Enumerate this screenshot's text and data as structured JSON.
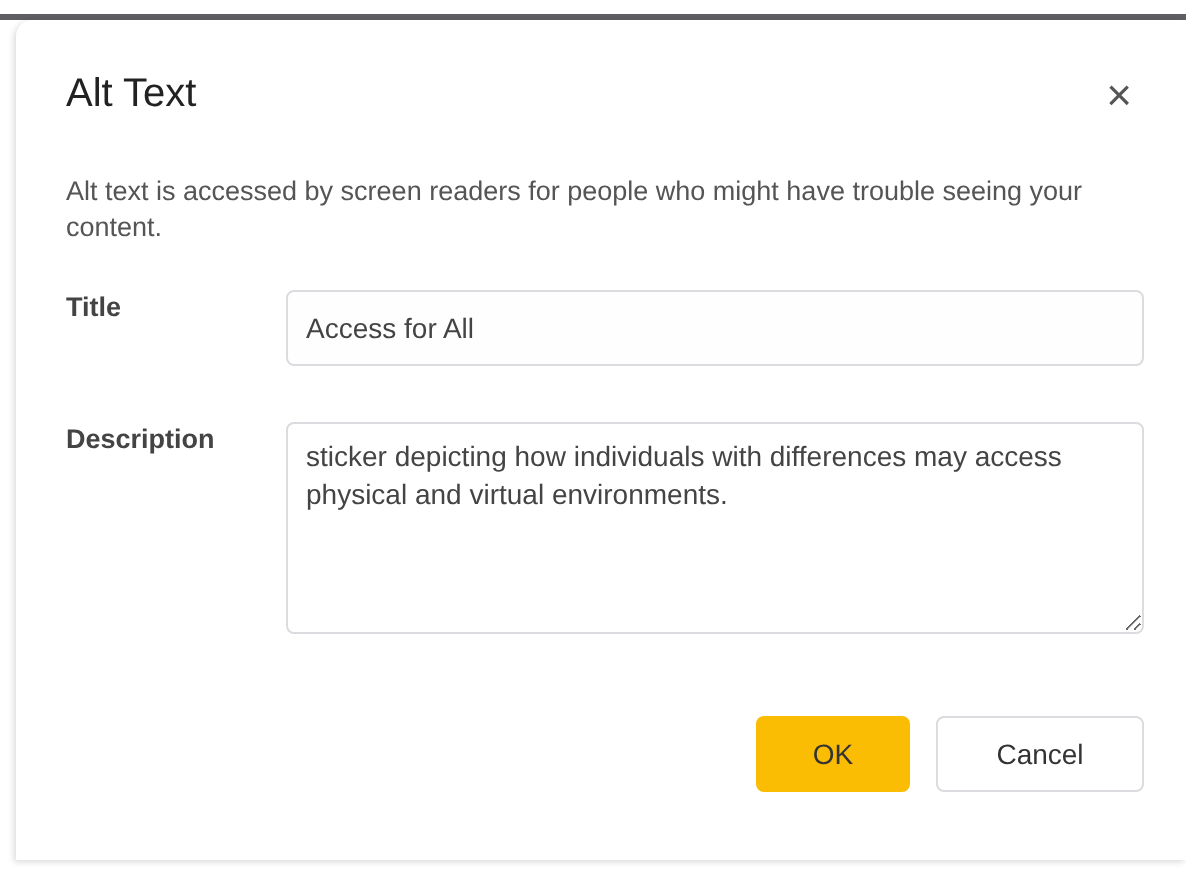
{
  "dialog": {
    "title": "Alt Text",
    "close": "×",
    "intro": "Alt text is accessed by screen readers for people who might have trouble seeing your content.",
    "fields": [
      {
        "label": "Title",
        "kind": "input",
        "value": "Access for All"
      },
      {
        "label": "Description",
        "kind": "textarea",
        "value": "sticker depicting how individuals with differences may access physical and virtual environments."
      }
    ],
    "buttons": [
      {
        "label": "OK",
        "kind": "primary"
      },
      {
        "label": "Cancel",
        "kind": "secondary"
      }
    ]
  }
}
